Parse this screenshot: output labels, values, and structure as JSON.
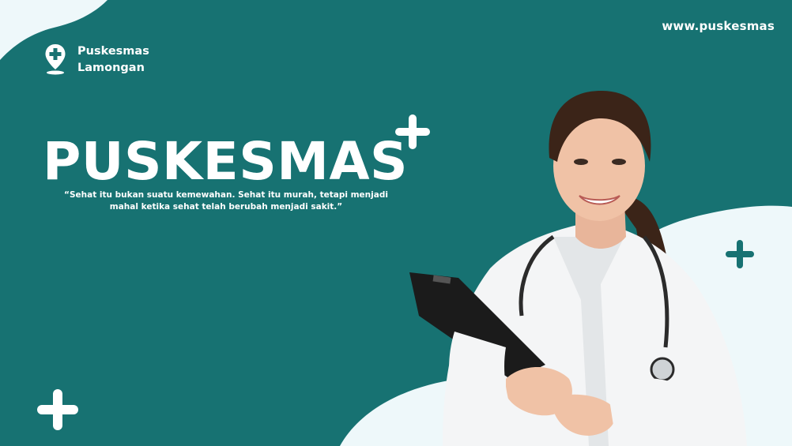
{
  "header": {
    "website": "www.puskesmas",
    "brand_line1": "Puskesmas",
    "brand_line2": "Lamongan"
  },
  "hero": {
    "headline": "PUSKESMAS",
    "quote": "“Sehat itu bukan suatu kemewahan. Sehat itu murah, tetapi menjadi mahal ketika sehat telah berubah menjadi sakit.”"
  },
  "colors": {
    "background": "#177272",
    "light_shape": "#eef8fa",
    "text": "#ffffff",
    "accent_plus": "#177272"
  },
  "icons": {
    "brand": "location-pin-cross-icon",
    "decor": "plus-icon"
  }
}
